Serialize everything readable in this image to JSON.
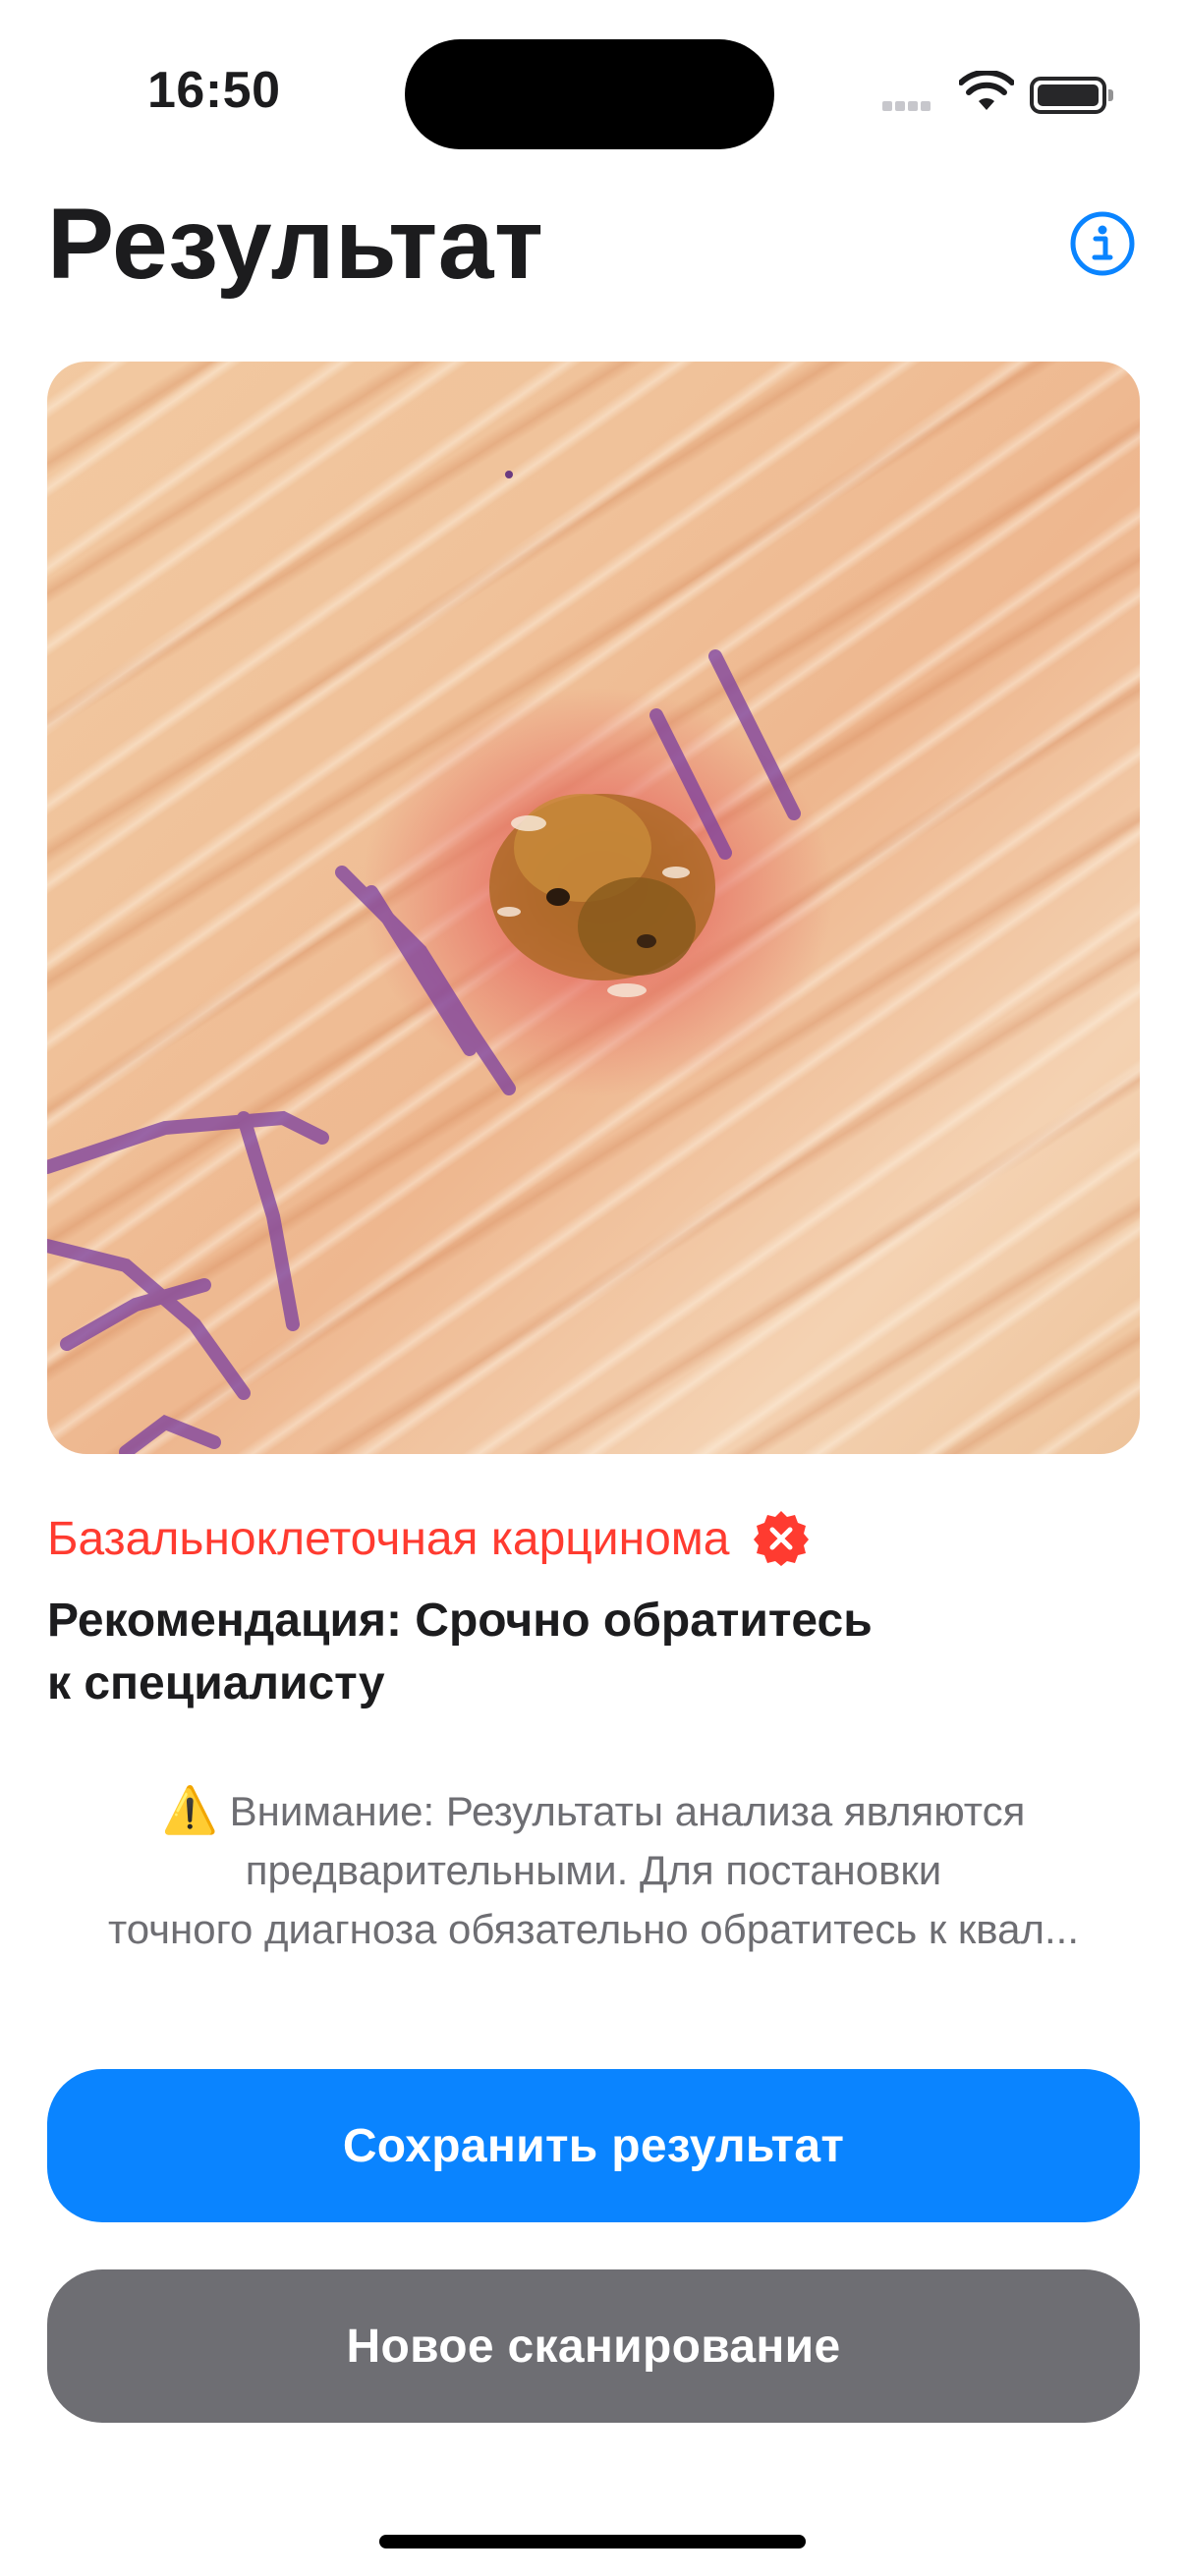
{
  "status_bar": {
    "time": "16:50"
  },
  "header": {
    "title": "Результат",
    "info_icon": "info-circle-icon"
  },
  "photo": {
    "description_icon": "skin-lesion-photo"
  },
  "result": {
    "diagnosis": "Базальноклеточная карцинома",
    "diagnosis_badge_icon": "xmark-seal-icon",
    "recommendation_line1": "Рекомендация: Срочно обратитесь",
    "recommendation_line2": "к специалисту"
  },
  "warning": {
    "icon": "⚠️",
    "line1": "Внимание: Результаты анализа являются",
    "line2": "предварительными. Для постановки",
    "line3": "точного диагноза обязательно обратитесь к квал..."
  },
  "buttons": {
    "save_label": "Сохранить результат",
    "new_scan_label": "Новое сканирование"
  },
  "colors": {
    "accent": "#0a84ff",
    "danger": "#ff3b30",
    "secondary_button": "#6e6e73"
  }
}
